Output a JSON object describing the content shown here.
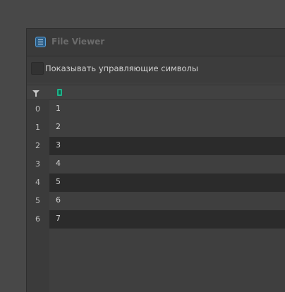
{
  "window": {
    "title": "File Viewer",
    "icon": "list-icon"
  },
  "options": {
    "show_control_chars_label": "Показывать управляющие символы",
    "show_control_chars_checked": false
  },
  "table": {
    "filter_icon": "filter-icon",
    "column_icon": "column-type-icon",
    "rows": [
      {
        "index": "0",
        "value": "1"
      },
      {
        "index": "1",
        "value": "2"
      },
      {
        "index": "2",
        "value": "3"
      },
      {
        "index": "3",
        "value": "4"
      },
      {
        "index": "4",
        "value": "5"
      },
      {
        "index": "5",
        "value": "6"
      },
      {
        "index": "6",
        "value": "7"
      }
    ]
  }
}
